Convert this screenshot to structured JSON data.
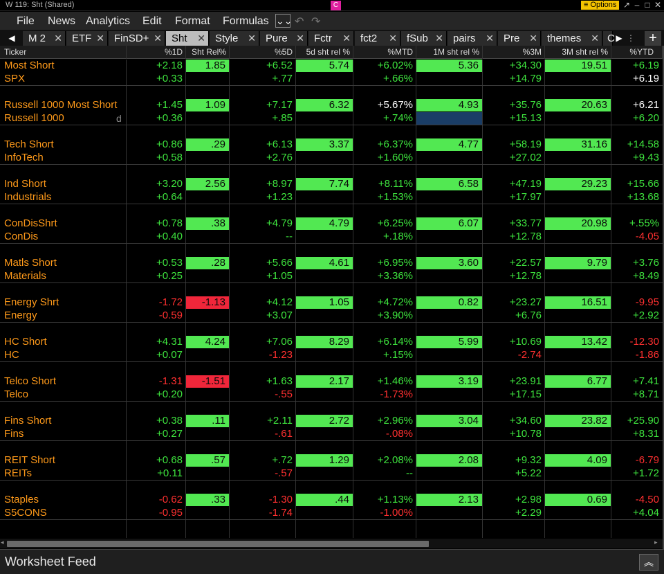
{
  "window": {
    "title": "W 119: Sht (Shared)",
    "badge": "C",
    "options_label": "≡ Options",
    "controls": [
      "↗",
      "–",
      "□",
      "✕"
    ]
  },
  "menu": {
    "items": [
      "File",
      "News",
      "Analytics",
      "Edit",
      "Format",
      "Formulas"
    ],
    "dropdown": "⌄⌄",
    "undo": "↶",
    "redo": "↷"
  },
  "tabs": {
    "prev": "◀",
    "next": "▶",
    "plus": "+",
    "items": [
      {
        "label": "M 2",
        "active": false
      },
      {
        "label": "ETF",
        "active": false
      },
      {
        "label": "FinSD+",
        "active": false
      },
      {
        "label": "Sht",
        "active": true
      },
      {
        "label": "Style",
        "active": false
      },
      {
        "label": "Pure",
        "active": false
      },
      {
        "label": "Fctr",
        "active": false
      },
      {
        "label": "fct2",
        "active": false
      },
      {
        "label": "fSub",
        "active": false
      },
      {
        "label": "pairs",
        "active": false
      },
      {
        "label": "Pre",
        "active": false
      },
      {
        "label": "themes",
        "active": false
      },
      {
        "label": "C",
        "active": false
      }
    ]
  },
  "columns": [
    "Ticker",
    "%1D",
    "Sht Rel%",
    "%5D",
    "5d sht rel %",
    "%MTD",
    "1M sht rel %",
    "%3M",
    "3M sht rel %",
    "%YTD"
  ],
  "groups": [
    {
      "short": {
        "name": "Most Short",
        "d1": "+2.18",
        "rel1": "1.85",
        "d5": "+6.52",
        "rel5": "5.74",
        "mtd": "+6.02%",
        "relm": "5.36",
        "m3": "+34.30",
        "rel3": "19.51",
        "ytd": "+6.19"
      },
      "bench": {
        "name": "SPX",
        "d1": "+0.33",
        "d5": "+.77",
        "mtd": "+.66%",
        "m3": "+14.79",
        "ytd": "+6.19"
      }
    },
    {
      "short": {
        "name": "Russell 1000 Most Short",
        "d1": "+1.45",
        "rel1": "1.09",
        "d5": "+7.17",
        "rel5": "6.32",
        "mtd": "+5.67%",
        "relm": "4.93",
        "m3": "+35.76",
        "rel3": "20.63",
        "ytd": "+6.21"
      },
      "bench": {
        "name": "Russell 1000",
        "flag": "d",
        "d1": "+0.36",
        "d5": "+.85",
        "mtd": "+.74%",
        "m3": "+15.13",
        "ytd": "+6.20"
      }
    },
    {
      "short": {
        "name": "Tech Short",
        "d1": "+0.86",
        "rel1": ".29",
        "d5": "+6.13",
        "rel5": "3.37",
        "mtd": "+6.37%",
        "relm": "4.77",
        "m3": "+58.19",
        "rel3": "31.16",
        "ytd": "+14.58"
      },
      "bench": {
        "name": "InfoTech",
        "d1": "+0.58",
        "d5": "+2.76",
        "mtd": "+1.60%",
        "m3": "+27.02",
        "ytd": "+9.43"
      }
    },
    {
      "short": {
        "name": "Ind Short",
        "d1": "+3.20",
        "rel1": "2.56",
        "d5": "+8.97",
        "rel5": "7.74",
        "mtd": "+8.11%",
        "relm": "6.58",
        "m3": "+47.19",
        "rel3": "29.23",
        "ytd": "+15.66"
      },
      "bench": {
        "name": "Industrials",
        "d1": "+0.64",
        "d5": "+1.23",
        "mtd": "+1.53%",
        "m3": "+17.97",
        "ytd": "+13.68"
      }
    },
    {
      "short": {
        "name": "ConDisShrt",
        "d1": "+0.78",
        "rel1": ".38",
        "d5": "+4.79",
        "rel5": "4.79",
        "mtd": "+6.25%",
        "relm": "6.07",
        "m3": "+33.77",
        "rel3": "20.98",
        "ytd": "+.55%"
      },
      "bench": {
        "name": "ConDis",
        "d1": "+0.40",
        "d5": "--",
        "mtd": "+.18%",
        "m3": "+12.78",
        "ytd": "-4.05"
      }
    },
    {
      "short": {
        "name": "Matls Short",
        "d1": "+0.53",
        "rel1": ".28",
        "d5": "+5.66",
        "rel5": "4.61",
        "mtd": "+6.95%",
        "relm": "3.60",
        "m3": "+22.57",
        "rel3": "9.79",
        "ytd": "+3.76"
      },
      "bench": {
        "name": "Materials",
        "d1": "+0.25",
        "d5": "+1.05",
        "mtd": "+3.36%",
        "m3": "+12.78",
        "ytd": "+8.49"
      }
    },
    {
      "short": {
        "name": "Energy Shrt",
        "d1": "-1.72",
        "rel1": "-1.13",
        "d5": "+4.12",
        "rel5": "1.05",
        "mtd": "+4.72%",
        "relm": "0.82",
        "m3": "+23.27",
        "rel3": "16.51",
        "ytd": "-9.95"
      },
      "bench": {
        "name": "Energy",
        "d1": "-0.59",
        "d5": "+3.07",
        "mtd": "+3.90%",
        "m3": "+6.76",
        "ytd": "+2.92"
      }
    },
    {
      "short": {
        "name": "HC Short",
        "d1": "+4.31",
        "rel1": "4.24",
        "d5": "+7.06",
        "rel5": "8.29",
        "mtd": "+6.14%",
        "relm": "5.99",
        "m3": "+10.69",
        "rel3": "13.42",
        "ytd": "-12.30"
      },
      "bench": {
        "name": "HC",
        "d1": "+0.07",
        "d5": "-1.23",
        "mtd": "+.15%",
        "m3": "-2.74",
        "ytd": "-1.86"
      }
    },
    {
      "short": {
        "name": "Telco Short",
        "d1": "-1.31",
        "rel1": "-1.51",
        "d5": "+1.63",
        "rel5": "2.17",
        "mtd": "+1.46%",
        "relm": "3.19",
        "m3": "+23.91",
        "rel3": "6.77",
        "ytd": "+7.41"
      },
      "bench": {
        "name": "Telco",
        "d1": "+0.20",
        "d5": "-.55",
        "mtd": "-1.73%",
        "m3": "+17.15",
        "ytd": "+8.71"
      }
    },
    {
      "short": {
        "name": "Fins Short",
        "d1": "+0.38",
        "rel1": ".11",
        "d5": "+2.11",
        "rel5": "2.72",
        "mtd": "+2.96%",
        "relm": "3.04",
        "m3": "+34.60",
        "rel3": "23.82",
        "ytd": "+25.90"
      },
      "bench": {
        "name": "Fins",
        "d1": "+0.27",
        "d5": "-.61",
        "mtd": "-.08%",
        "m3": "+10.78",
        "ytd": "+8.31"
      }
    },
    {
      "short": {
        "name": "REIT Short",
        "d1": "+0.68",
        "rel1": ".57",
        "d5": "+.72",
        "rel5": "1.29",
        "mtd": "+2.08%",
        "relm": "2.08",
        "m3": "+9.32",
        "rel3": "4.09",
        "ytd": "-6.79"
      },
      "bench": {
        "name": "REITs",
        "d1": "+0.11",
        "d5": "-.57",
        "mtd": "--",
        "m3": "+5.22",
        "ytd": "+1.72"
      }
    },
    {
      "short": {
        "name": "Staples",
        "d1": "-0.62",
        "rel1": ".33",
        "d5": "-1.30",
        "rel5": ".44",
        "mtd": "+1.13%",
        "relm": "2.13",
        "m3": "+2.98",
        "rel3": "0.69",
        "ytd": "-4.50"
      },
      "bench": {
        "name": "S5CONS",
        "d1": "-0.95",
        "d5": "-1.74",
        "mtd": "-1.00%",
        "m3": "+2.29",
        "ytd": "+4.04"
      }
    }
  ],
  "footer": {
    "label": "Worksheet Feed",
    "expand_icon": "︽"
  },
  "scrollbar": {
    "left_arrow": "◂",
    "right_arrow": "▸"
  },
  "colors": {
    "positive": "#3ee43e",
    "negative": "#ff3030",
    "ticker": "#ff9a1a",
    "cell_green": "#52e852",
    "cell_red": "#f0263a",
    "selected": "#1a3d66"
  }
}
